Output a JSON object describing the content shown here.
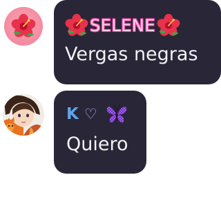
{
  "messages": [
    {
      "username": "SELENE",
      "username_decoration_icon": "hibiscus-emoji",
      "text": "Vergas negras",
      "avatar_icon": "hibiscus-emoji"
    },
    {
      "username_letter": "K",
      "username_heart": "♡",
      "username_decoration_icon": "butterfly-emoji",
      "text": "Quiero",
      "avatar_icon": "anime-character-avatar"
    }
  ],
  "colors": {
    "bubble_bg": "#282637",
    "message_text": "#f2f2f4",
    "username_1_fill": "#ffd1e6",
    "username_1_glow": "#ff3fa7",
    "username_2_letter": "#5ea6ea",
    "username_2_heart": "#b7b3ff",
    "avatar_1_bg": "#f58ea3"
  }
}
